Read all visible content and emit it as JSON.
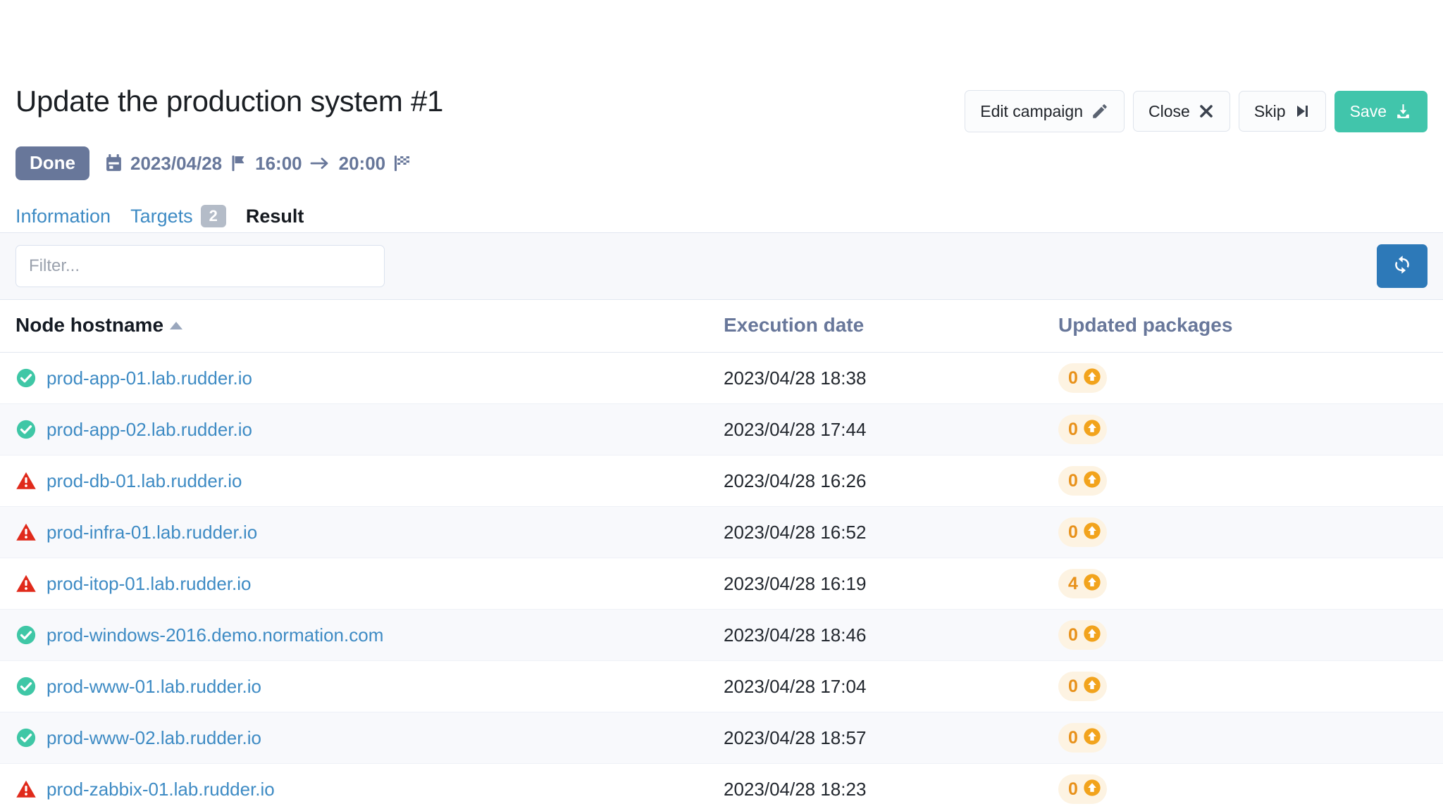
{
  "header": {
    "title": "Update the production system #1",
    "actions": [
      {
        "label": "Edit campaign",
        "icon": "pencil-icon",
        "style": "default"
      },
      {
        "label": "Close",
        "icon": "close-icon",
        "style": "default"
      },
      {
        "label": "Skip",
        "icon": "skip-forward-icon",
        "style": "default"
      },
      {
        "label": "Save",
        "icon": "save-download-icon",
        "style": "primary"
      }
    ],
    "status": {
      "badge": "Done",
      "badge_color": "#68779a",
      "calendar_icon": "calendar-icon",
      "date": "2023/04/28",
      "start_flag_icon": "flag-icon",
      "start_time": "16:00",
      "arrow_icon": "arrow-right-icon",
      "end_time": "20:00",
      "end_flag_icon": "checkered-flag-icon"
    }
  },
  "tabs": [
    {
      "label": "Information",
      "badge": null,
      "active": false
    },
    {
      "label": "Targets",
      "badge": "2",
      "active": false
    },
    {
      "label": "Result",
      "badge": null,
      "active": true
    }
  ],
  "toolbar": {
    "filter_placeholder": "Filter...",
    "filter_value": "",
    "refresh_icon": "refresh-icon",
    "refresh_color": "#2d79b8"
  },
  "table": {
    "columns": [
      {
        "label": "Node hostname",
        "sorted": true,
        "sort_direction": "asc"
      },
      {
        "label": "Execution date",
        "sorted": false,
        "sort_direction": null
      },
      {
        "label": "Updated packages",
        "sorted": false,
        "sort_direction": null
      }
    ],
    "rows": [
      {
        "status": "success",
        "hostname": "prod-app-01.lab.rudder.io",
        "date": "2023/04/28 18:38",
        "packages": "0"
      },
      {
        "status": "success",
        "hostname": "prod-app-02.lab.rudder.io",
        "date": "2023/04/28 17:44",
        "packages": "0"
      },
      {
        "status": "error",
        "hostname": "prod-db-01.lab.rudder.io",
        "date": "2023/04/28 16:26",
        "packages": "0"
      },
      {
        "status": "error",
        "hostname": "prod-infra-01.lab.rudder.io",
        "date": "2023/04/28 16:52",
        "packages": "0"
      },
      {
        "status": "error",
        "hostname": "prod-itop-01.lab.rudder.io",
        "date": "2023/04/28 16:19",
        "packages": "4"
      },
      {
        "status": "success",
        "hostname": "prod-windows-2016.demo.normation.com",
        "date": "2023/04/28 18:46",
        "packages": "0"
      },
      {
        "status": "success",
        "hostname": "prod-www-01.lab.rudder.io",
        "date": "2023/04/28 17:04",
        "packages": "0"
      },
      {
        "status": "success",
        "hostname": "prod-www-02.lab.rudder.io",
        "date": "2023/04/28 18:57",
        "packages": "0"
      },
      {
        "status": "error",
        "hostname": "prod-zabbix-01.lab.rudder.io",
        "date": "2023/04/28 18:23",
        "packages": "0"
      }
    ]
  },
  "colors": {
    "link": "#3e8bc4",
    "success": "#3fc7a6",
    "error": "#e02a1b",
    "badge_orange": "#e8911a",
    "save_green": "#41c5ab",
    "muted": "#68779a"
  }
}
